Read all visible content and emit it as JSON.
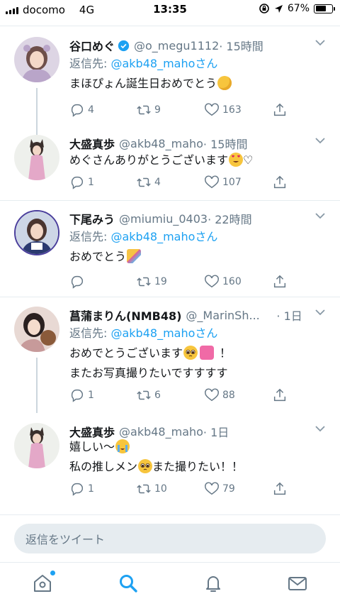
{
  "status_bar": {
    "carrier": "docomo",
    "network": "4G",
    "time": "13:35",
    "battery_text": "67%",
    "battery_level": 0.67
  },
  "colors": {
    "accent": "#1da1f2",
    "text": "#14171a",
    "secondary": "#657786",
    "divider": "#e6ecf0"
  },
  "tweets": [
    {
      "name": "谷口めぐ",
      "verified": true,
      "handle": "@o_megu1112",
      "time": "· 15時間",
      "reply_prefix": "返信先: ",
      "reply_to": "@akb48_mahoさん",
      "text": "まほぴょん誕生日おめでとう",
      "emoji": "partying-face",
      "replies": "4",
      "retweets": "9",
      "likes": "163"
    },
    {
      "name": "大盛真歩",
      "handle": "@akb48_maho",
      "time": "· 15時間",
      "text": "めぐさんありがとうございます",
      "text_suffix": "♡",
      "emoji": "heart-eyes",
      "replies": "1",
      "retweets": "4",
      "likes": "107"
    },
    {
      "name": "下尾みう",
      "handle": "@miumiu_0403",
      "time": "· 22時間",
      "reply_prefix": "返信先: ",
      "reply_to": "@akb48_mahoさん",
      "text": "おめでとう",
      "emoji": "party-popper",
      "replies": "",
      "retweets": "19",
      "likes": "160"
    },
    {
      "name": "菖蒲まりん(NMB48)",
      "handle": "@_MarinSh...",
      "time": "· 1日",
      "reply_prefix": "返信先: ",
      "reply_to": "@akb48_mahoさん",
      "text_line1": "おめでとうございます",
      "text_line1_suffix": "！",
      "text_line2": "またお写真撮りたいですすすす",
      "emoji1": "pleading-face",
      "emoji2": "growing-heart",
      "replies": "1",
      "retweets": "6",
      "likes": "88"
    },
    {
      "name": "大盛真歩",
      "handle": "@akb48_maho",
      "time": "· 1日",
      "text_line1": "嬉しい〜",
      "text_line2_a": "私の推しメン",
      "text_line2_b": "また撮りたい！！",
      "emoji1": "loudly-crying-face",
      "emoji2": "pleading-face",
      "replies": "1",
      "retweets": "10",
      "likes": "79"
    }
  ],
  "reply_box": {
    "placeholder": "返信をツイート"
  },
  "tabbar": {
    "items": [
      "home-icon",
      "search-icon",
      "notifications-icon",
      "messages-icon"
    ],
    "active": "search-icon"
  }
}
